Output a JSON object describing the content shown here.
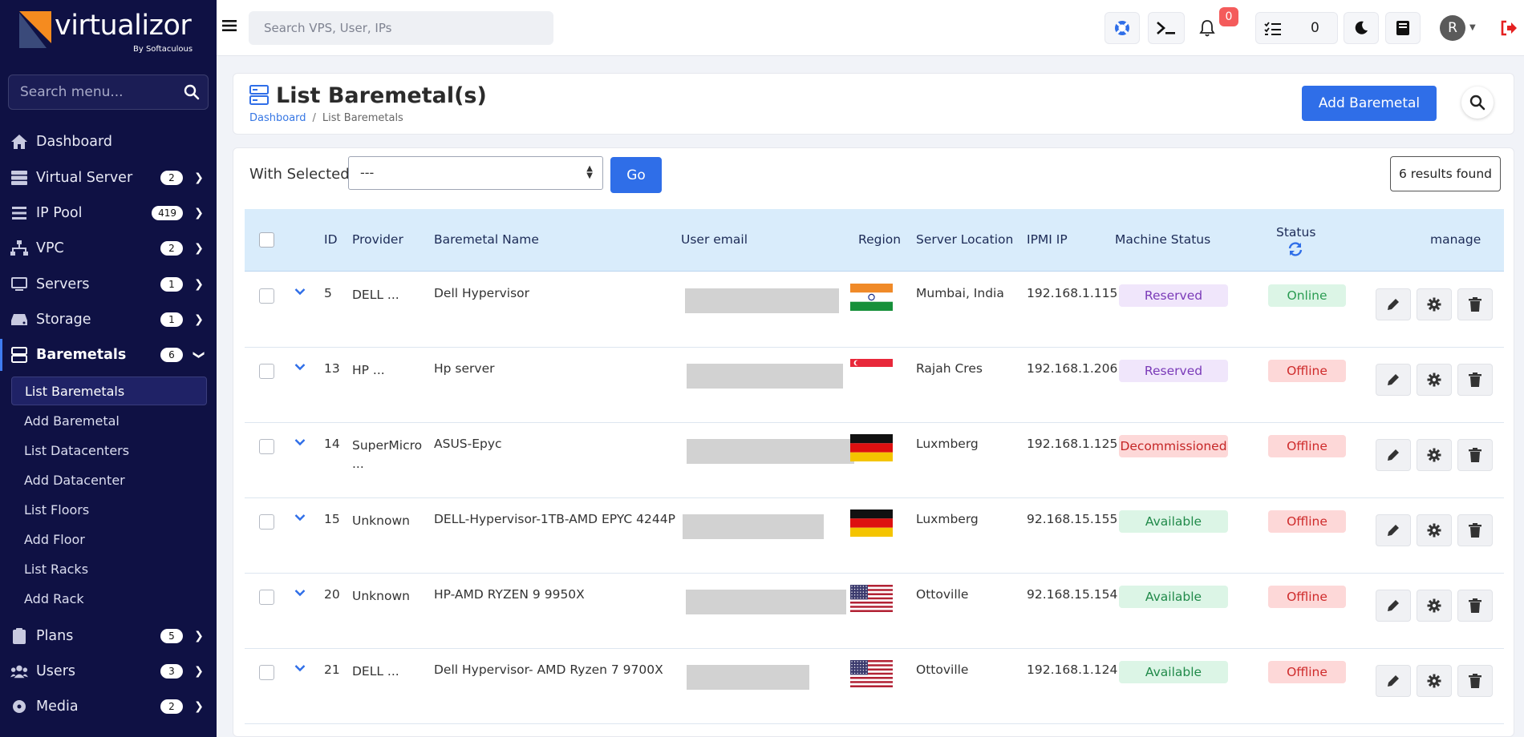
{
  "brand": {
    "name": "virtualizor",
    "sub": "By Softaculous"
  },
  "sidebar": {
    "search_placeholder": "Search menu...",
    "items": [
      {
        "label": "Dashboard",
        "badge": "",
        "icon": "home-icon"
      },
      {
        "label": "Virtual Server",
        "badge": "2",
        "icon": "server-stack-icon"
      },
      {
        "label": "IP Pool",
        "badge": "419",
        "icon": "list-icon"
      },
      {
        "label": "VPC",
        "badge": "2",
        "icon": "network-icon"
      },
      {
        "label": "Servers",
        "badge": "1",
        "icon": "monitor-icon"
      },
      {
        "label": "Storage",
        "badge": "1",
        "icon": "hdd-icon"
      },
      {
        "label": "Baremetals",
        "badge": "6",
        "icon": "baremetal-icon"
      },
      {
        "label": "Plans",
        "badge": "5",
        "icon": "clipboard-icon"
      },
      {
        "label": "Users",
        "badge": "3",
        "icon": "users-icon"
      },
      {
        "label": "Media",
        "badge": "2",
        "icon": "disc-icon"
      }
    ],
    "sub_items": [
      "List Baremetals",
      "Add Baremetal",
      "List Datacenters",
      "Add Datacenter",
      "List Floors",
      "Add Floor",
      "List Racks",
      "Add Rack"
    ]
  },
  "topbar": {
    "search_placeholder": "Search VPS, User, IPs",
    "notification_count": "0",
    "tasks_count": "0",
    "avatar_initial": "R"
  },
  "header": {
    "title": "List Baremetal(s)",
    "breadcrumb_home": "Dashboard",
    "breadcrumb_sep": "/",
    "breadcrumb_current": "List Baremetals",
    "add_button": "Add Baremetal"
  },
  "toolbar": {
    "with_selected": "With Selected",
    "select_value": "---",
    "go_button": "Go",
    "results": "6 results found"
  },
  "table": {
    "headers": {
      "id": "ID",
      "provider": "Provider",
      "name": "Baremetal Name",
      "email": "User email",
      "region": "Region",
      "location": "Server Location",
      "ipmi": "IPMI IP",
      "machine_status": "Machine Status",
      "status": "Status",
      "manage": "manage"
    },
    "rows": [
      {
        "id": "5",
        "provider": "DELL ...",
        "provider2": "",
        "name": "Dell Hypervisor",
        "flag": "india",
        "location": "Mumbai, India",
        "ipmi": "192.168.1.115",
        "machine_status": "Reserved",
        "machine_kind": "reserved",
        "status": "Online",
        "status_kind": "online"
      },
      {
        "id": "13",
        "provider": "HP ...",
        "provider2": "",
        "name": "Hp server",
        "flag": "singapore",
        "location": "Rajah Cres",
        "ipmi": "192.168.1.206",
        "machine_status": "Reserved",
        "machine_kind": "reserved",
        "status": "Offline",
        "status_kind": "offline"
      },
      {
        "id": "14",
        "provider": "SuperMicro",
        "provider2": "...",
        "name": "ASUS-Epyc",
        "flag": "germany",
        "location": "Luxmberg",
        "ipmi": "192.168.1.125",
        "machine_status": "Decommissioned",
        "machine_kind": "decom",
        "status": "Offline",
        "status_kind": "offline"
      },
      {
        "id": "15",
        "provider": "Unknown",
        "provider2": "",
        "name": "DELL-Hypervisor-1TB-AMD EPYC 4244P",
        "flag": "germany",
        "location": "Luxmberg",
        "ipmi": "92.168.15.155",
        "machine_status": "Available",
        "machine_kind": "available",
        "status": "Offline",
        "status_kind": "offline"
      },
      {
        "id": "20",
        "provider": "Unknown",
        "provider2": "",
        "name": "HP-AMD RYZEN 9 9950X",
        "flag": "usa",
        "location": "Ottoville",
        "ipmi": "92.168.15.154",
        "machine_status": "Available",
        "machine_kind": "available",
        "status": "Offline",
        "status_kind": "offline"
      },
      {
        "id": "21",
        "provider": "DELL ...",
        "provider2": "",
        "name": "Dell Hypervisor- AMD Ryzen 7 9700X",
        "flag": "usa",
        "location": "Ottoville",
        "ipmi": "192.168.1.124",
        "machine_status": "Available",
        "machine_kind": "available",
        "status": "Offline",
        "status_kind": "offline"
      }
    ]
  },
  "colors": {
    "sidebar_bg": "#0f1144",
    "accent": "#2f6ee8",
    "table_header_bg": "#d9ecfb"
  }
}
